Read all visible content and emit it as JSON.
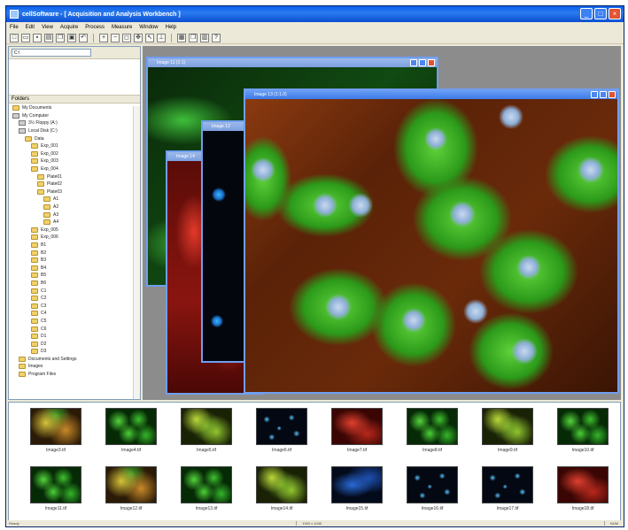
{
  "window": {
    "title": "cellSoftware - [ Acquisition and Analysis Workbench ]"
  },
  "menu": [
    "File",
    "Edit",
    "View",
    "Acquire",
    "Process",
    "Measure",
    "Window",
    "Help"
  ],
  "toolbar_icons": [
    "new-icon",
    "open-icon",
    "save-icon",
    "print-icon",
    "copy-icon",
    "paste-icon",
    "undo-icon",
    "zoom-in-icon",
    "zoom-out-icon",
    "fit-icon",
    "pan-icon",
    "select-icon",
    "measure-icon",
    "grid-icon",
    "cascade-icon",
    "tile-icon",
    "help-icon"
  ],
  "left_panel": {
    "address": "C:\\",
    "tree_header": "Folders",
    "tree": [
      {
        "label": "My Documents",
        "depth": 0,
        "kind": "folder"
      },
      {
        "label": "My Computer",
        "depth": 0,
        "kind": "drive"
      },
      {
        "label": "3½ Floppy (A:)",
        "depth": 1,
        "kind": "drive"
      },
      {
        "label": "Local Disk (C:)",
        "depth": 1,
        "kind": "drive"
      },
      {
        "label": "Data",
        "depth": 2,
        "kind": "folder"
      },
      {
        "label": "Exp_001",
        "depth": 3,
        "kind": "folder"
      },
      {
        "label": "Exp_002",
        "depth": 3,
        "kind": "folder"
      },
      {
        "label": "Exp_003",
        "depth": 3,
        "kind": "folder"
      },
      {
        "label": "Exp_004",
        "depth": 3,
        "kind": "folder"
      },
      {
        "label": "Plate01",
        "depth": 4,
        "kind": "folder"
      },
      {
        "label": "Plate02",
        "depth": 4,
        "kind": "folder"
      },
      {
        "label": "Plate03",
        "depth": 4,
        "kind": "folder"
      },
      {
        "label": "A1",
        "depth": 5,
        "kind": "folder"
      },
      {
        "label": "A2",
        "depth": 5,
        "kind": "folder"
      },
      {
        "label": "A3",
        "depth": 5,
        "kind": "folder"
      },
      {
        "label": "A4",
        "depth": 5,
        "kind": "folder"
      },
      {
        "label": "Exp_005",
        "depth": 3,
        "kind": "folder"
      },
      {
        "label": "Exp_006",
        "depth": 3,
        "kind": "folder"
      },
      {
        "label": "B1",
        "depth": 3,
        "kind": "folder"
      },
      {
        "label": "B2",
        "depth": 3,
        "kind": "folder"
      },
      {
        "label": "B3",
        "depth": 3,
        "kind": "folder"
      },
      {
        "label": "B4",
        "depth": 3,
        "kind": "folder"
      },
      {
        "label": "B5",
        "depth": 3,
        "kind": "folder"
      },
      {
        "label": "B6",
        "depth": 3,
        "kind": "folder"
      },
      {
        "label": "C1",
        "depth": 3,
        "kind": "folder"
      },
      {
        "label": "C2",
        "depth": 3,
        "kind": "folder"
      },
      {
        "label": "C3",
        "depth": 3,
        "kind": "folder"
      },
      {
        "label": "C4",
        "depth": 3,
        "kind": "folder"
      },
      {
        "label": "C5",
        "depth": 3,
        "kind": "folder"
      },
      {
        "label": "C6",
        "depth": 3,
        "kind": "folder"
      },
      {
        "label": "D1",
        "depth": 3,
        "kind": "folder"
      },
      {
        "label": "D2",
        "depth": 3,
        "kind": "folder"
      },
      {
        "label": "D3",
        "depth": 3,
        "kind": "folder"
      },
      {
        "label": "Documents and Settings",
        "depth": 1,
        "kind": "folder"
      },
      {
        "label": "Images",
        "depth": 1,
        "kind": "folder"
      },
      {
        "label": "Program Files",
        "depth": 1,
        "kind": "folder"
      }
    ]
  },
  "subwindows": [
    {
      "title": "Image 11 (1:1)",
      "style": "green"
    },
    {
      "title": "Image 14",
      "style": "red"
    },
    {
      "title": "Image 12",
      "style": "blue"
    },
    {
      "title": "Image 13 (1:1.0)",
      "style": "green-main"
    }
  ],
  "thumbnails": [
    {
      "caption": "Image3.tif",
      "palette": "mixed-yellow"
    },
    {
      "caption": "Image4.tif",
      "palette": "green"
    },
    {
      "caption": "Image5.tif",
      "palette": "yellow-green"
    },
    {
      "caption": "Image6.tif",
      "palette": "blue-dots"
    },
    {
      "caption": "Image7.tif",
      "palette": "red"
    },
    {
      "caption": "Image8.tif",
      "palette": "green"
    },
    {
      "caption": "Image9.tif",
      "palette": "yellow-green"
    },
    {
      "caption": "Image10.tif",
      "palette": "green"
    },
    {
      "caption": "Image11.tif",
      "palette": "green"
    },
    {
      "caption": "Image12.tif",
      "palette": "mixed-yellow"
    },
    {
      "caption": "Image13.tif",
      "palette": "green"
    },
    {
      "caption": "Image14.tif",
      "palette": "yellow-green"
    },
    {
      "caption": "Image15.tif",
      "palette": "blue"
    },
    {
      "caption": "Image16.tif",
      "palette": "blue-dots"
    },
    {
      "caption": "Image17.tif",
      "palette": "blue-dots"
    },
    {
      "caption": "Image18.tif",
      "palette": "red"
    }
  ],
  "status": {
    "left": "Ready",
    "mid": "1392 x 1040",
    "right": "NUM"
  }
}
